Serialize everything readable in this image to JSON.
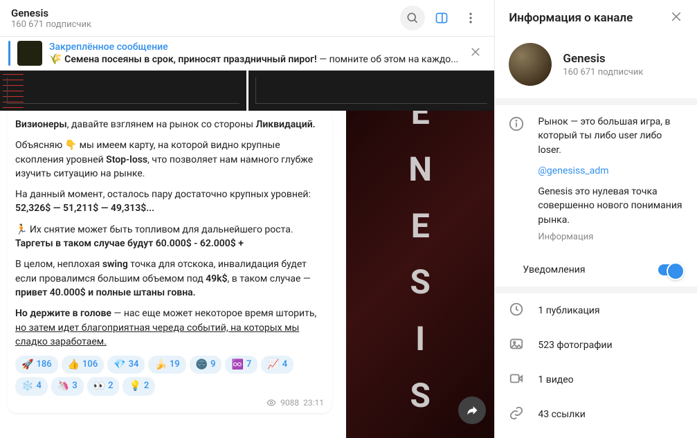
{
  "header": {
    "title": "Genesis",
    "subscribers": "160 671 подписчик"
  },
  "pinned": {
    "title": "Закреплённое сообщение",
    "emoji": "🌾",
    "bold": "Семена посеяны в срок, приносят праздничный пирог!",
    "rest": " — помните об этом на каждо..."
  },
  "bg_letters": [
    "E",
    "N",
    "E",
    "S",
    "I",
    "S"
  ],
  "message": {
    "p1_a": "Визионеры",
    "p1_b": ", давайте взглянем на рынок со стороны ",
    "p1_c": "Ликвидаций.",
    "p2_a": "Объясняю ",
    "p2_emoji": "👇",
    "p2_b": " мы имеем карту, на которой видно крупные скопления уровней ",
    "p2_c": "Stop-loss",
    "p2_d": ", что позволяет нам намного глубже изучить ситуацию на рынке.",
    "p3_a": "На данный момент, осталось пару достаточно крупных уровней: ",
    "p3_b": "52,326$ — 51,211$ — 49,313$...",
    "p4_emoji": "🏃",
    "p4_a": " Их снятие может быть топливом для дальнейшего роста. ",
    "p4_b": "Таргеты в таком случае будут 60.000$ - 62.000$ +",
    "p5_a": "В целом, неплохая ",
    "p5_b": "swing",
    "p5_c": " точка для отскока, инвалидация будет если провалимся большим объемом под ",
    "p5_d": "49k$",
    "p5_e": ", в таком случае — ",
    "p5_f": "привет 40.000$ и полные штаны говна.",
    "p6_a": "Но держите в голове",
    "p6_b": " — нас еще может некоторое время шторить, ",
    "p6_c": "но затем идет благоприятная череда событий, на которых мы сладко заработаем."
  },
  "reactions": [
    {
      "e": "🚀",
      "n": "186"
    },
    {
      "e": "👍",
      "n": "106"
    },
    {
      "e": "💎",
      "n": "34"
    },
    {
      "e": "🍌",
      "n": "19"
    },
    {
      "e": "🌚",
      "n": "9"
    },
    {
      "e": "♾️",
      "n": "7"
    },
    {
      "e": "📈",
      "n": "4"
    },
    {
      "e": "❄️",
      "n": "4"
    },
    {
      "e": "🦄",
      "n": "3"
    },
    {
      "e": "👀",
      "n": "2"
    },
    {
      "e": "💡",
      "n": "2"
    }
  ],
  "meta": {
    "views": "9088",
    "time": "23:11"
  },
  "side": {
    "title": "Информация о канале",
    "name": "Genesis",
    "subscribers": "160 671 подписчик",
    "bio1": "Рынок — это большая игра, в который ты либо user либо loser.",
    "link": "@genesiss_adm",
    "bio2": "Genesis это нулевая точка совершенно нового понимания рынка.",
    "bio_meta": "Информация",
    "notif": "Уведомления",
    "stats": {
      "pub": "1 публикация",
      "photos": "523 фотографии",
      "video": "1 видео",
      "links": "43 ссылки"
    }
  }
}
